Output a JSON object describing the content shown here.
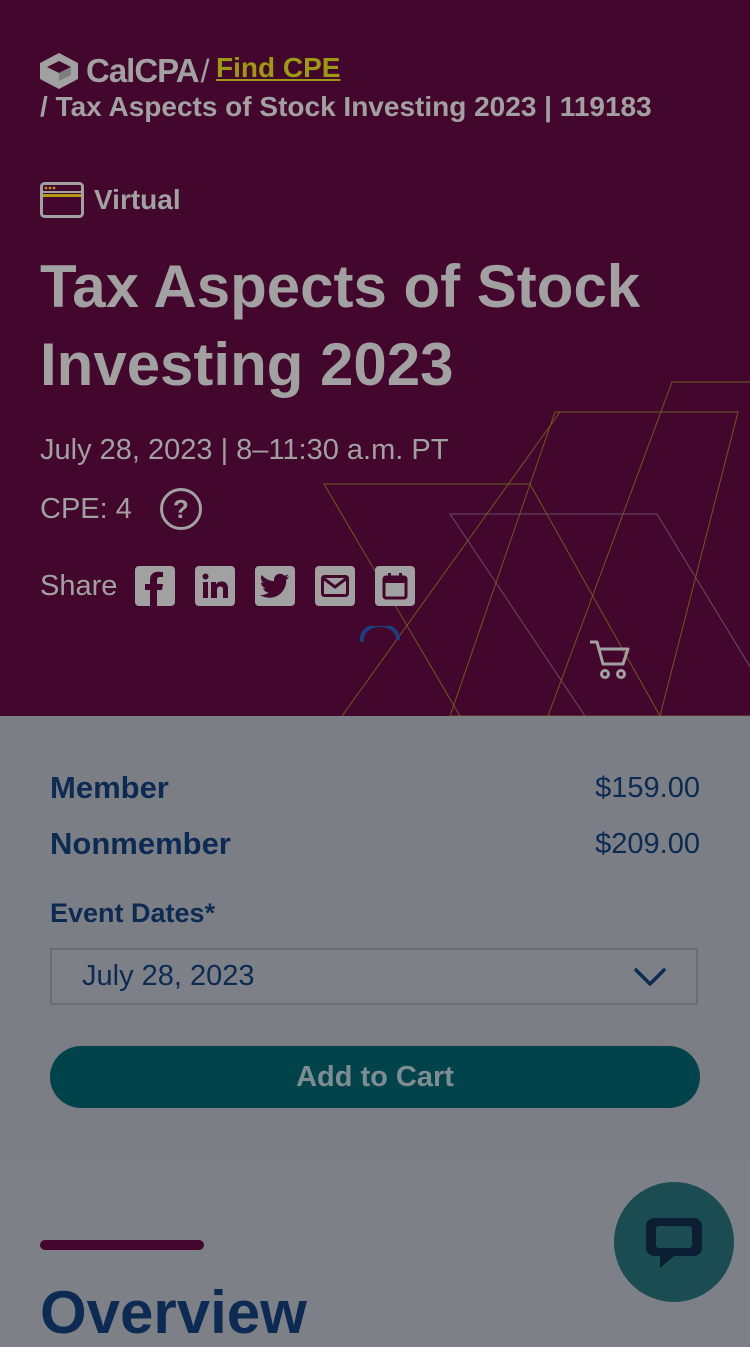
{
  "breadcrumb": {
    "logo_text": "CalCPA",
    "separator": "/",
    "link_label": "Find CPE",
    "current": "/ Tax Aspects of Stock Investing 2023 | 119183"
  },
  "event": {
    "format": "Virtual",
    "title": "Tax Aspects of Stock Investing 2023",
    "date_time": "July 28, 2023 | 8–11:30 a.m. PT",
    "cpe": "CPE: 4",
    "help_symbol": "?"
  },
  "share": {
    "label": "Share",
    "icons": [
      "facebook-icon",
      "linkedin-icon",
      "twitter-icon",
      "email-icon",
      "calendar-icon"
    ]
  },
  "pricing": {
    "member_label": "Member",
    "member_price": "$159.00",
    "nonmember_label": "Nonmember",
    "nonmember_price": "$209.00",
    "event_dates_label": "Event Dates*",
    "selected_date": "July 28, 2023",
    "add_to_cart": "Add to Cart"
  },
  "overview": {
    "title": "Overview"
  },
  "colors": {
    "hero_bg": "#43062c",
    "link": "#9c9a12",
    "navy": "#0c2a52",
    "cart_button": "#00434a",
    "chat_button": "#1a4c52"
  }
}
